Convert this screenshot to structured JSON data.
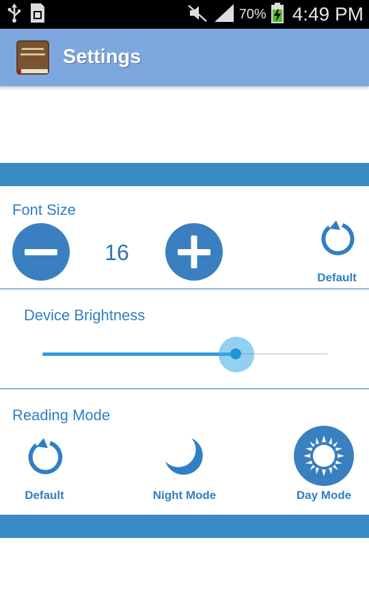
{
  "status_bar": {
    "battery_percent": "70%",
    "time": "4:49 PM",
    "icons": [
      "usb-icon",
      "sim-card-icon",
      "muted-icon",
      "signal-icon",
      "battery-charging-icon"
    ]
  },
  "action_bar": {
    "title": "Settings",
    "color": "#7ea7e0"
  },
  "font_size": {
    "title": "Font Size",
    "value": "16",
    "default_label": "Default"
  },
  "brightness": {
    "title": "Device Brightness",
    "level_percent": 68
  },
  "reading_mode": {
    "title": "Reading Mode",
    "options": [
      {
        "label": "Default",
        "icon": "refresh-icon",
        "selected": false
      },
      {
        "label": "Night Mode",
        "icon": "moon-icon",
        "selected": false
      },
      {
        "label": "Day Mode",
        "icon": "sun-icon",
        "selected": true
      }
    ]
  },
  "colors": {
    "accent": "#3a7fbf",
    "band": "#3a8ac5",
    "text_blue": "#2f7fc4"
  }
}
